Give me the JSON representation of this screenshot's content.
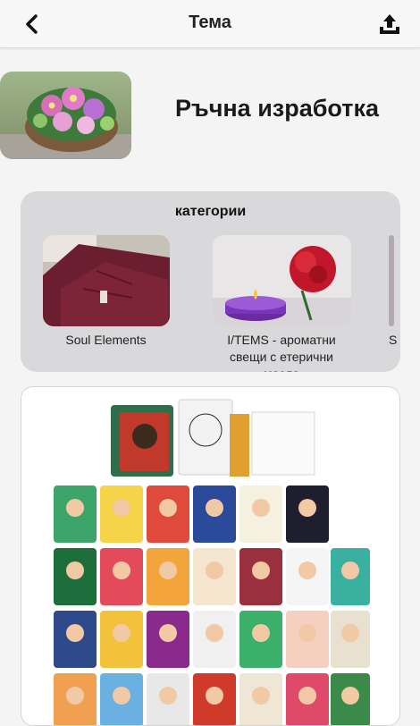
{
  "header": {
    "title": "Тема",
    "back_icon": "chevron-left-icon",
    "upload_icon": "upload-icon"
  },
  "topic": {
    "name": "Ръчна изработка",
    "image_alt": "flower basket photo"
  },
  "categories": {
    "title": "категории",
    "items": [
      {
        "label": "Soul Elements"
      },
      {
        "label": "I/TEMS - ароматни свещи с етерични масла"
      },
      {
        "label": "S"
      }
    ]
  },
  "post": {
    "image_alt": "illustrated cards photo"
  }
}
